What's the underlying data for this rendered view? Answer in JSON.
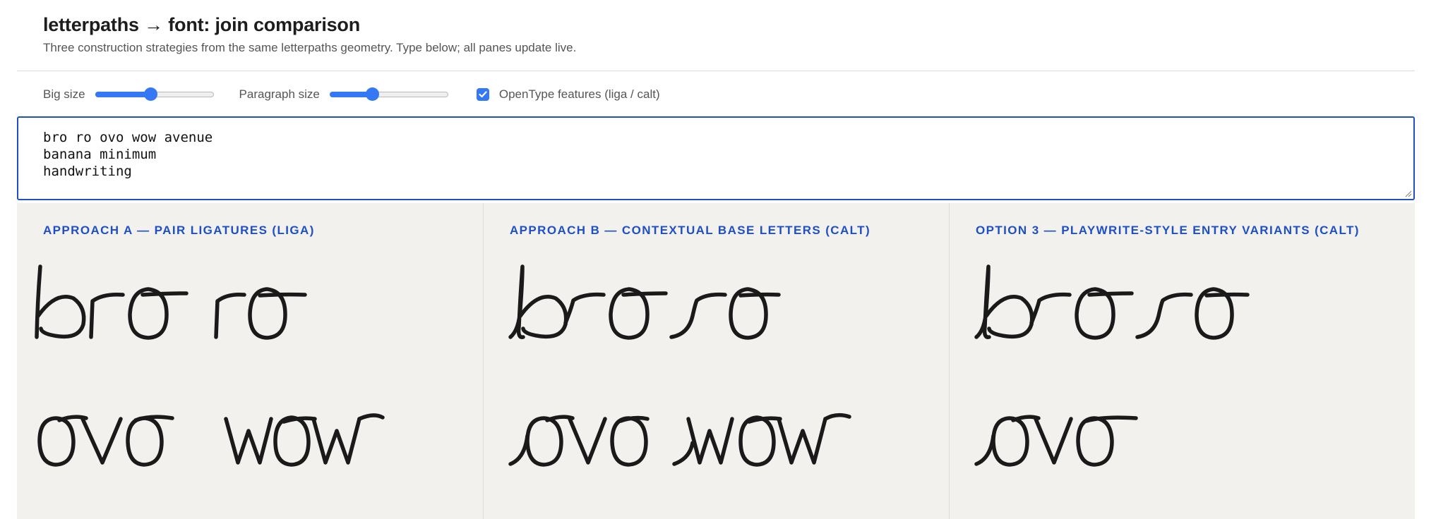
{
  "header": {
    "title": "letterpaths → font: join comparison",
    "subtitle": "Three construction strategies from the same letterpaths geometry. Type below; all panes update live."
  },
  "controls": {
    "big_size_label": "Big size",
    "big_size_value": 0.47,
    "paragraph_size_label": "Paragraph size",
    "paragraph_size_value": 0.36,
    "opentype_label": "OpenType features (liga / calt)",
    "opentype_checked": true
  },
  "editor": {
    "lines": [
      "bro ro ovo wow avenue",
      "banana minimum",
      "handwriting"
    ]
  },
  "panes": [
    {
      "title": "APPROACH A — PAIR LIGATURES (LIGA)"
    },
    {
      "title": "APPROACH B — CONTEXTUAL BASE LETTERS (CALT)"
    },
    {
      "title": "OPTION 3 — PLAYWRITE-STYLE ENTRY VARIANTS (CALT)"
    }
  ],
  "colors": {
    "accent": "#1e4fc4",
    "slider": "#3478f6",
    "pane_bg": "#f2f1ed",
    "ink": "#1a1a1a"
  }
}
